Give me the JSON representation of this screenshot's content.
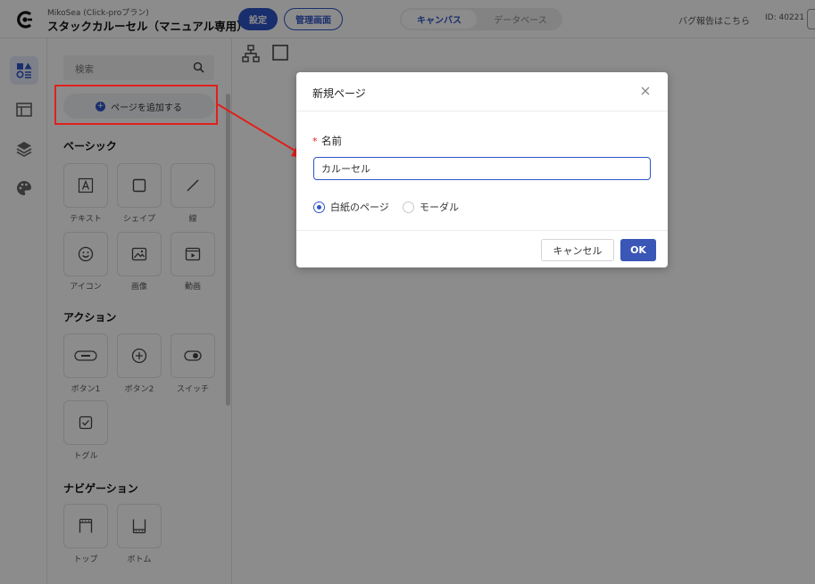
{
  "header": {
    "app_subtitle": "MikoSea (Click-proプラン)",
    "app_title": "スタックカルーセル（マニュアル専用）",
    "settings_label": "設定",
    "admin_label": "管理画面",
    "tabs": [
      {
        "label": "キャンバス",
        "active": true
      },
      {
        "label": "データベース",
        "active": false
      }
    ],
    "bug_report": "バグ報告はこちら",
    "user_id": "ID: 40221"
  },
  "rail": {
    "items": [
      {
        "icon": "components-icon",
        "active": true
      },
      {
        "icon": "layout-icon",
        "active": false
      },
      {
        "icon": "layers-icon",
        "active": false
      },
      {
        "icon": "palette-icon",
        "active": false
      }
    ]
  },
  "panel": {
    "search_placeholder": "検索",
    "add_page_label": "ページを追加する",
    "sections": [
      {
        "title": "ベーシック",
        "items": [
          {
            "label": "テキスト",
            "icon": "text-icon"
          },
          {
            "label": "シェイプ",
            "icon": "shape-icon"
          },
          {
            "label": "線",
            "icon": "line-icon"
          },
          {
            "label": "アイコン",
            "icon": "smiley-icon"
          },
          {
            "label": "画像",
            "icon": "image-icon"
          },
          {
            "label": "動画",
            "icon": "video-icon"
          }
        ]
      },
      {
        "title": "アクション",
        "items": [
          {
            "label": "ボタン1",
            "icon": "button-text-icon"
          },
          {
            "label": "ボタン2",
            "icon": "plus-circle-icon"
          },
          {
            "label": "スイッチ",
            "icon": "switch-icon"
          },
          {
            "label": "トグル",
            "icon": "checkbox-icon"
          }
        ]
      },
      {
        "title": "ナビゲーション",
        "items": [
          {
            "label": "トップ",
            "icon": "top-nav-icon"
          },
          {
            "label": "ボトム",
            "icon": "bottom-nav-icon"
          }
        ]
      }
    ]
  },
  "modal": {
    "title": "新規ページ",
    "name_label": "名前",
    "required_mark": "*",
    "name_value": "カルーセル",
    "radio_options": [
      {
        "label": "白紙のページ",
        "checked": true
      },
      {
        "label": "モーダル",
        "checked": false
      }
    ],
    "cancel_label": "キャンセル",
    "ok_label": "OK"
  },
  "colors": {
    "accent": "#2f55c7",
    "annotation": "#e0201c"
  }
}
